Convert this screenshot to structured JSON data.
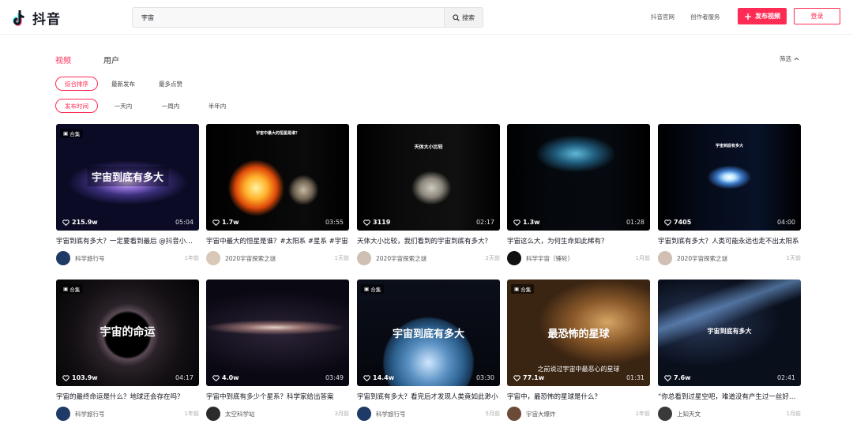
{
  "header": {
    "logo_text": "抖音",
    "search": {
      "value": "宇宙",
      "button_label": "搜索"
    },
    "nav": {
      "official_site": "抖音官网",
      "creator_service": "创作者服务"
    },
    "upload_label": "发布视频",
    "login_label": "登录",
    "brand_color": "#fe2c55"
  },
  "tabs": [
    {
      "label": "视频",
      "active": true
    },
    {
      "label": "用户",
      "active": false
    }
  ],
  "filter_toggle": "筛选",
  "sort_options": [
    {
      "label": "综合排序",
      "selected": true
    },
    {
      "label": "最新发布",
      "selected": false
    },
    {
      "label": "最多点赞",
      "selected": false
    }
  ],
  "time_options": [
    {
      "label": "发布时间",
      "selected": true
    },
    {
      "label": "一天内",
      "selected": false
    },
    {
      "label": "一周内",
      "selected": false
    },
    {
      "label": "半年内",
      "selected": false
    }
  ],
  "videos": [
    {
      "badge": "合集",
      "overlay": "宇宙到底有多大",
      "likes": "215.9w",
      "duration": "05:04",
      "title": "宇宙到底有多大？一定要看到最后 @抖音小助手",
      "author": "科学旅行号",
      "time": "1年前",
      "thumb": "galaxy"
    },
    {
      "badge": "",
      "overlay": "宇宙中最大的恒星是谁？",
      "likes": "1.7w",
      "duration": "03:55",
      "title": "宇宙中最大的恒星是谁？#太阳系 #星系 #宇宙",
      "author": "2020宇宙探索之谜",
      "time": "1天前",
      "thumb": "sun"
    },
    {
      "badge": "",
      "overlay": "天体大小比较",
      "likes": "3119",
      "duration": "02:17",
      "title": "天体大小比较，我们看到的宇宙到底有多大？",
      "author": "2020宇宙探索之谜",
      "time": "2天前",
      "thumb": "asteroid"
    },
    {
      "badge": "",
      "overlay": "",
      "likes": "1.3w",
      "duration": "01:28",
      "title": "宇宙这么大，为何生命如此稀有？",
      "author": "科学宇宙（锤轮）",
      "time": "1月前",
      "thumb": "nebula"
    },
    {
      "badge": "",
      "overlay": "宇宙到底有多大",
      "likes": "7405",
      "duration": "04:00",
      "title": "宇宙到底有多大？人类可能永远也走不出太阳系",
      "author": "2020宇宙探索之谜",
      "time": "1天前",
      "thumb": "burst"
    },
    {
      "badge": "合集",
      "overlay": "宇宙的命运",
      "likes": "103.9w",
      "duration": "04:17",
      "title": "宇宙的最终命运是什么？地球还会存在吗？",
      "author": "科学旅行号",
      "time": "1年前",
      "thumb": "blackhole"
    },
    {
      "badge": "",
      "overlay": "",
      "likes": "4.0w",
      "duration": "03:49",
      "title": "宇宙中到底有多少个星系？科学家给出答案",
      "author": "太空科学站",
      "time": "3月前",
      "thumb": "milkyway"
    },
    {
      "badge": "合集",
      "overlay": "宇宙到底有多大",
      "likes": "14.4w",
      "duration": "03:30",
      "title": "宇宙到底有多大？看完后才发现人类竟如此渺小",
      "author": "科学旅行号",
      "time": "5月前",
      "thumb": "earth"
    },
    {
      "badge": "合集",
      "overlay": "最恐怖的星球",
      "subtitle": "之前说过宇宙中最恶心的星球",
      "likes": "77.1w",
      "duration": "01:31",
      "title": "宇宙中，最恐怖的星球是什么？",
      "author": "宇宙大爆炸",
      "time": "1年前",
      "thumb": "dust"
    },
    {
      "badge": "",
      "overlay": "宇宙到底有多大",
      "likes": "7.6w",
      "duration": "02:41",
      "title": "“你总看到过星空吧，难道没有产生过一丝好奇？",
      "author": "上知天文",
      "time": "1月前",
      "thumb": "streak"
    }
  ]
}
